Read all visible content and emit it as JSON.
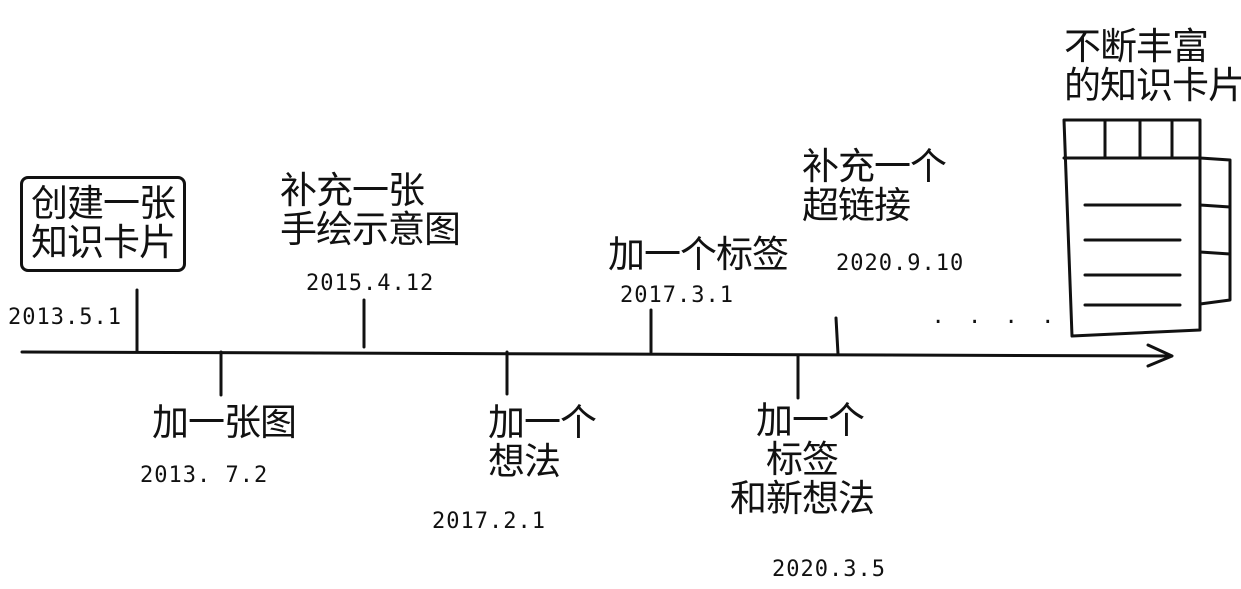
{
  "events": [
    {
      "label_lines": [
        "创建一张",
        "知识卡片"
      ],
      "date": "2013.5.1"
    },
    {
      "label_lines": [
        "加一张图"
      ],
      "date": "2013. 7.2"
    },
    {
      "label_lines": [
        "补充一张",
        "手绘示意图"
      ],
      "date": "2015.4.12"
    },
    {
      "label_lines": [
        "加一个",
        "想法"
      ],
      "date": "2017.2.1"
    },
    {
      "label_lines": [
        "加一个标签"
      ],
      "date": "2017.3.1"
    },
    {
      "label_lines": [
        "加一个",
        "标签",
        "和新想法"
      ],
      "date": "2020.3.5"
    },
    {
      "label_lines": [
        "补充一个",
        "超链接"
      ],
      "date": "2020.9.10"
    }
  ],
  "ellipsis": ". . . .",
  "result": {
    "label_lines": [
      "不断丰富",
      "的知识卡片"
    ]
  },
  "colors": {
    "ink": "#111111",
    "background": "#ffffff"
  }
}
